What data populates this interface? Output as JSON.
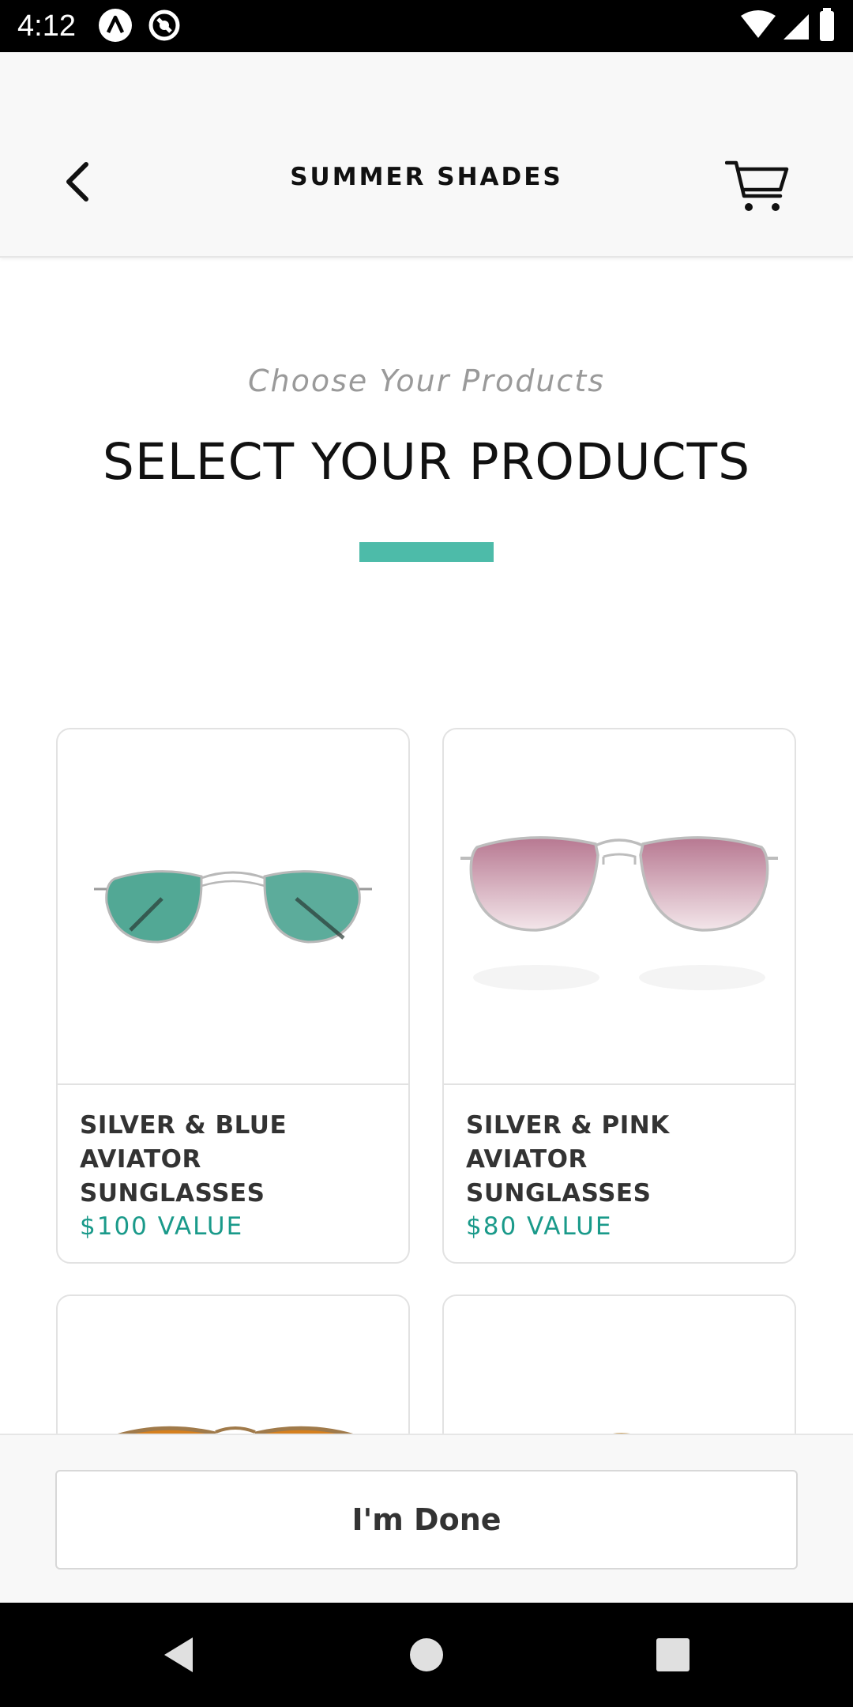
{
  "status_bar": {
    "time": "4:12"
  },
  "header": {
    "title": "SUMMER SHADES",
    "back_icon": "chevron-left-icon",
    "cart_icon": "cart-icon"
  },
  "intro": {
    "subtitle": "Choose Your Products",
    "title": "SELECT YOUR PRODUCTS"
  },
  "colors": {
    "accent": "#4dbba9",
    "price": "#1a9a8a",
    "text_dark": "#333333"
  },
  "products": [
    {
      "name": "SILVER & BLUE AVIATOR SUNGLASSES",
      "price": "$100 VALUE",
      "lens_color": "#3f9e8a",
      "frame_color": "#b8b8b8"
    },
    {
      "name": "SILVER & PINK AVIATOR SUNGLASSES",
      "price": "$80 VALUE",
      "lens_color": "#c48a9e",
      "frame_color": "#bdbdbd"
    },
    {
      "name": "",
      "price": "",
      "lens_color": "#d6801e",
      "frame_color": "#a07a4a"
    },
    {
      "name": "",
      "price": "",
      "lens_color": "#3fd68a",
      "frame_color": "#c8a060"
    }
  ],
  "footer": {
    "done_label": "I'm Done"
  }
}
